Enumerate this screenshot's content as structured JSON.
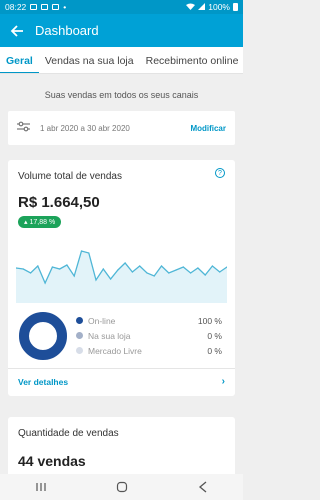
{
  "status_bar": {
    "time": "08:22",
    "battery": "100%"
  },
  "app_bar": {
    "title": "Dashboard"
  },
  "tabs": [
    {
      "label": "Geral",
      "active": true
    },
    {
      "label": "Vendas na sua loja",
      "active": false
    },
    {
      "label": "Recebimento online",
      "active": false
    }
  ],
  "section_title": "Suas vendas em todos os seus canais",
  "filter": {
    "date_range": "1 abr 2020 a 30 abr 2020",
    "action": "Modificar"
  },
  "sales_volume": {
    "title": "Volume total de vendas",
    "help": "?",
    "amount": "R$ 1.664,50",
    "change": "17,88 %",
    "detail_link": "Ver detalhes",
    "chevron": "›",
    "legend": [
      {
        "name": "On-line",
        "pct": "100 %",
        "color": "#1e4e99"
      },
      {
        "name": "Na sua loja",
        "pct": "0 %",
        "color": "#a3b0c8"
      },
      {
        "name": "Mercado Livre",
        "pct": "0 %",
        "color": "#d7dde8"
      }
    ],
    "online_share": 1.0
  },
  "sales_qty": {
    "title": "Quantidade de vendas",
    "value": "44 vendas"
  },
  "colors": {
    "primary": "#00a1d6",
    "status": "#0097c7",
    "positive": "#1ca35a",
    "chart_line": "#4fb6d6"
  },
  "chart_data": {
    "type": "area",
    "x": [
      1,
      2,
      3,
      4,
      5,
      6,
      7,
      8,
      9,
      10,
      11,
      12,
      13,
      14,
      15,
      16,
      17,
      18,
      19,
      20,
      21,
      22,
      23,
      24,
      25,
      26,
      27,
      28,
      29,
      30
    ],
    "values": [
      35,
      34,
      30,
      37,
      20,
      36,
      34,
      38,
      27,
      52,
      50,
      23,
      34,
      24,
      33,
      40,
      31,
      37,
      30,
      27,
      37,
      30,
      33,
      36,
      30,
      35,
      28,
      37,
      31,
      36
    ],
    "title": "",
    "xlabel": "",
    "ylabel": "",
    "ylim": [
      0,
      60
    ],
    "grid": false
  }
}
